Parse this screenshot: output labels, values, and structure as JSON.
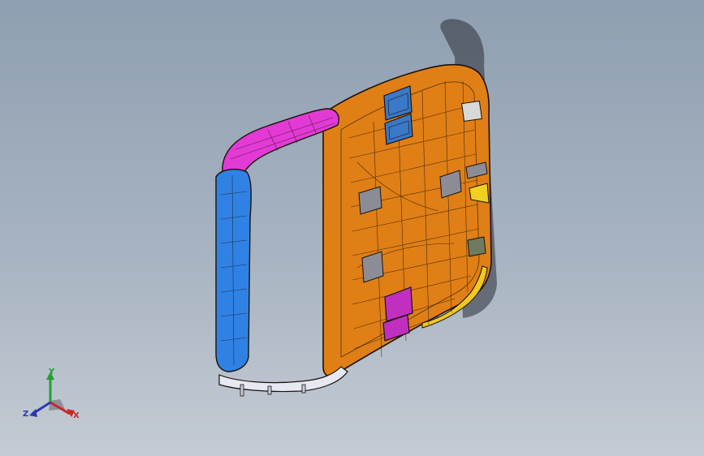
{
  "graphics_area": {
    "background_top": "#8f9fb1",
    "background_bottom": "#c4cbd4"
  },
  "model": {
    "colors": {
      "door_panel": "#e07f16",
      "upper_pillar": "#e33ad6",
      "side_pillar": "#2f82e3",
      "lower_rail": "#e6e8f2",
      "window_pockets": "#3a78c8",
      "lower_pockets": "#c02fc0",
      "accent_yellow": "#f0d020",
      "outline": "#1a1208"
    }
  },
  "triad": {
    "x_label": "X",
    "y_label": "Y",
    "z_label": "Z",
    "x_color": "#c82828",
    "y_color": "#22a032",
    "z_color": "#2a3aa8"
  }
}
